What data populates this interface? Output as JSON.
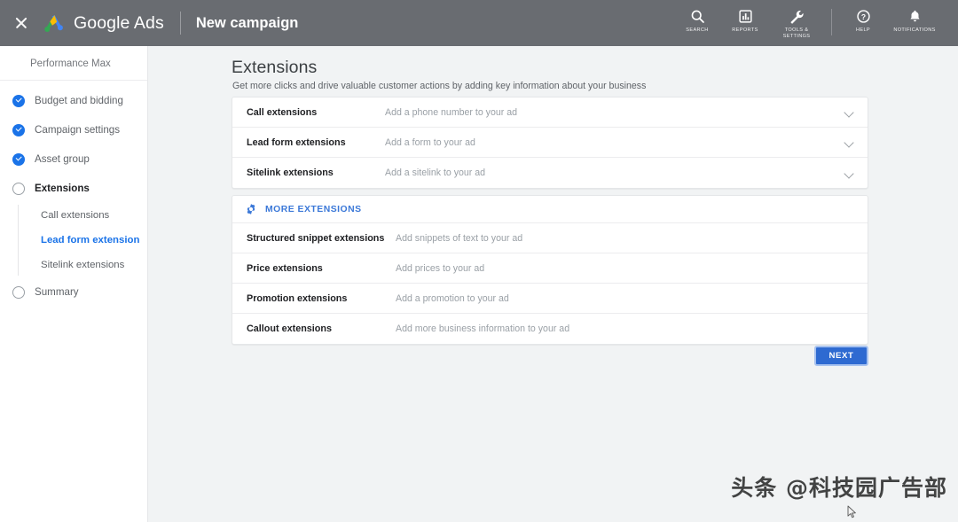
{
  "topbar": {
    "close_icon": "close-icon",
    "logo_icon": "google-ads-logo-icon",
    "brand": "Google Ads",
    "subtitle": "New campaign",
    "actions": [
      {
        "label": "Search",
        "icon": "search-icon"
      },
      {
        "label": "Reports",
        "icon": "bar-chart-icon"
      },
      {
        "label": "Tools &\nSettings",
        "icon": "wrench-icon"
      },
      {
        "label": "Help",
        "icon": "help-circle-icon"
      },
      {
        "label": "Notifications",
        "icon": "bell-icon"
      }
    ],
    "background_color": "#696c71"
  },
  "sidebar": {
    "campaign_type": "Performance Max",
    "items": [
      {
        "label": "Budget and bidding",
        "state": "done"
      },
      {
        "label": "Campaign settings",
        "state": "done"
      },
      {
        "label": "Asset group",
        "state": "done"
      },
      {
        "label": "Extensions",
        "state": "current"
      },
      {
        "label": "Summary",
        "state": "open"
      }
    ],
    "sub_items": [
      {
        "label": "Call extensions",
        "active": false
      },
      {
        "label": "Lead form extension",
        "active": true
      },
      {
        "label": "Sitelink extensions",
        "active": false
      }
    ],
    "accent_color": "#1a73e8"
  },
  "main": {
    "title": "Extensions",
    "subtitle": "Get more clicks and drive valuable customer actions by adding key information about your business",
    "primary_extensions": [
      {
        "name": "Call extensions",
        "description": "Add a phone number to your ad",
        "chevron": "chevron-down-icon"
      },
      {
        "name": "Lead form extensions",
        "description": "Add a form to your ad",
        "chevron": "chevron-down-icon"
      },
      {
        "name": "Sitelink extensions",
        "description": "Add a sitelink to your ad",
        "chevron": "chevron-down-icon"
      }
    ],
    "more_header": {
      "label": "MORE EXTENSIONS",
      "icon": "gear-icon",
      "color": "#3b78d8"
    },
    "more_extensions": [
      {
        "name": "Structured snippet extensions",
        "description": "Add snippets of text to your ad"
      },
      {
        "name": "Price extensions",
        "description": "Add prices to your ad"
      },
      {
        "name": "Promotion extensions",
        "description": "Add a promotion to your ad"
      },
      {
        "name": "Callout extensions",
        "description": "Add more business information to your ad"
      }
    ],
    "next_button": "NEXT",
    "next_button_color": "#2e6ad1"
  },
  "watermark": {
    "text": "头条 @科技园广告部"
  }
}
